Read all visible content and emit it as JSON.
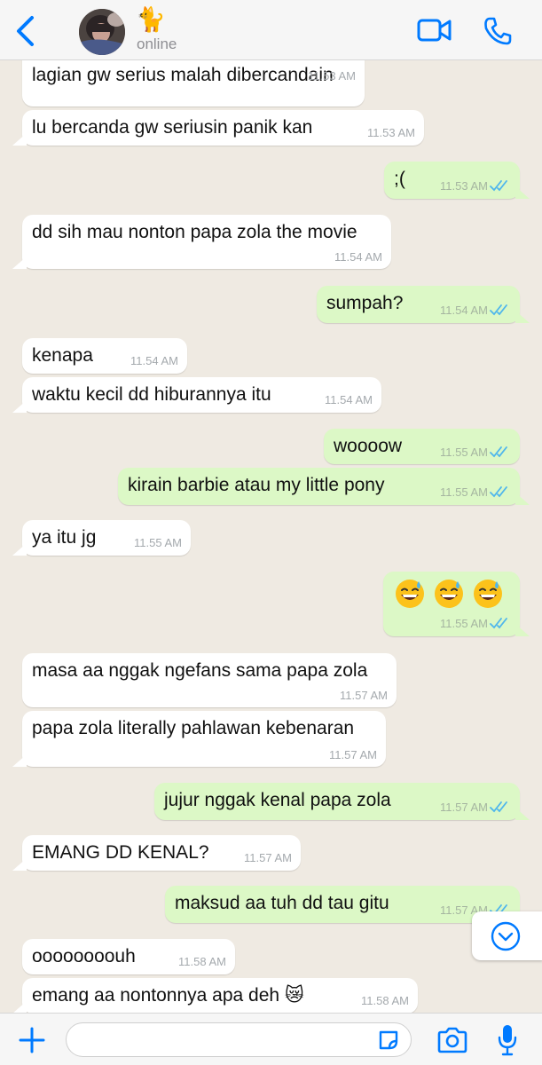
{
  "header": {
    "contact_name": "🐈",
    "status": "online",
    "accent_color": "#007aff"
  },
  "messages": [
    {
      "dir": "in",
      "text": "lagian gw serius malah dibercandain",
      "time": "11.53 AM"
    },
    {
      "dir": "in",
      "text": "lu bercanda gw seriusin panik kan",
      "time": "11.53 AM"
    },
    {
      "dir": "out",
      "text": ";(",
      "time": "11.53 AM",
      "read": true
    },
    {
      "dir": "in",
      "text": "dd sih mau nonton papa zola the movie",
      "time": "11.54 AM"
    },
    {
      "dir": "out",
      "text": "sumpah?",
      "time": "11.54 AM",
      "read": true
    },
    {
      "dir": "in",
      "text": "kenapa",
      "time": "11.54 AM"
    },
    {
      "dir": "in",
      "text": "waktu kecil dd hiburannya itu",
      "time": "11.54 AM"
    },
    {
      "dir": "out",
      "text": "woooow",
      "time": "11.55 AM",
      "read": true
    },
    {
      "dir": "out",
      "text": "kirain barbie atau my little pony",
      "time": "11.55 AM",
      "read": true
    },
    {
      "dir": "in",
      "text": "ya itu jg",
      "time": "11.55 AM"
    },
    {
      "dir": "out",
      "text": "😅😅😅",
      "time": "11.55 AM",
      "read": true
    },
    {
      "dir": "in",
      "text": "masa aa nggak ngefans sama papa zola",
      "time": "11.57 AM"
    },
    {
      "dir": "in",
      "text": "papa zola literally pahlawan kebenaran",
      "time": "11.57 AM"
    },
    {
      "dir": "out",
      "text": "jujur nggak kenal papa zola",
      "time": "11.57 AM",
      "read": true
    },
    {
      "dir": "in",
      "text": "EMANG DD KENAL?",
      "time": "11.57 AM"
    },
    {
      "dir": "out",
      "text": "maksud aa tuh dd tau gitu",
      "time": "11.57 AM",
      "read": true
    },
    {
      "dir": "in",
      "text": "oooooooouh",
      "time": "11.58 AM"
    },
    {
      "dir": "in",
      "text": "emang aa nontonnya apa deh 😿",
      "time": "11.58 AM"
    }
  ],
  "input": {
    "placeholder": ""
  },
  "icons": {
    "back": "chevron-left-icon",
    "video": "video-camera-icon",
    "call": "phone-icon",
    "scroll_down": "chevron-down-icon",
    "attach": "plus-icon",
    "sticker": "sticker-icon",
    "camera": "camera-icon",
    "mic": "microphone-icon"
  },
  "colors": {
    "incoming_bubble": "#ffffff",
    "outgoing_bubble": "#dcf8c6",
    "background": "#efeae2",
    "read_tick": "#4fb6ec"
  }
}
